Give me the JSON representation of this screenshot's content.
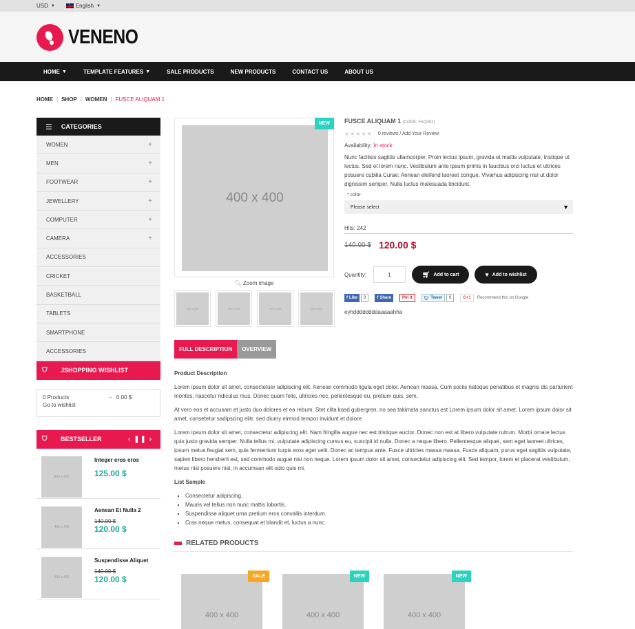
{
  "topbar": {
    "currency": "USD",
    "language": "English"
  },
  "logo": {
    "text": "VENENO"
  },
  "nav": [
    "HOME",
    "TEMPLATE FEATURES",
    "SALE PRODUCTS",
    "NEW PRODUCTS",
    "CONTACT US",
    "ABOUT US"
  ],
  "breadcrumb": {
    "home": "HOME",
    "shop": "SHOP",
    "women": "WOMEN",
    "current": "FUSCE ALIQUAM 1"
  },
  "categories": {
    "title": "CATEGORIES",
    "items": [
      {
        "label": "WOMEN",
        "expand": "+"
      },
      {
        "label": "MEN",
        "expand": "+"
      },
      {
        "label": "FOOTWEAR",
        "expand": "+"
      },
      {
        "label": "JEWELLERY",
        "expand": "+"
      },
      {
        "label": "COMPUTER",
        "expand": "+"
      },
      {
        "label": "CAMERA",
        "expand": "+"
      },
      {
        "label": "ACCESSORIES",
        "expand": ""
      },
      {
        "label": "CRICKET",
        "expand": ""
      },
      {
        "label": "BASKETBALL",
        "expand": ""
      },
      {
        "label": "TABLETS",
        "expand": ""
      },
      {
        "label": "SMARTPHONE",
        "expand": ""
      },
      {
        "label": "ACCESSORIES",
        "expand": ""
      }
    ]
  },
  "wishlist": {
    "title": "JSHOPPING WISHLIST",
    "products": "0 Products",
    "dash": "-",
    "total": "0.00 $",
    "link": "Go to wishlist"
  },
  "bestseller": {
    "title": "BESTSELLER",
    "items": [
      {
        "name": "Integer eros eros",
        "old_price": "",
        "price": "125.00 $"
      },
      {
        "name": "Aenean Et Nulla 2",
        "old_price": "140.00 $",
        "price": "120.00 $"
      },
      {
        "name": "Suspendisse Aliquet",
        "old_price": "140.00 $",
        "price": "120.00 $"
      }
    ]
  },
  "placeholder": {
    "large": "400 x 400",
    "small": "400 x 400"
  },
  "product": {
    "badge": "NEW",
    "zoom_label": "Zoom image",
    "title": "FUSCE ALIQUAM 1",
    "code": "(CODE: FAQ001)",
    "reviews": "0 reviews / Add Your Review",
    "availability_label": "Availability:",
    "availability_value": "In stock",
    "description": "Nunc facilisis sagittis ullamcorper. Proin lectus ipsum, gravida et mattis vulputate, tristique ut lectus. Sed et lorem nunc. Vestibulum ante ipsum primis in faucibus orci luctus et ultrices posuere cubilia Curae; Aenean eleifend laoreet congue. Vivamus adipiscing nisl ut dolor dignissim semper. Nulla luctus malesuada tincidunt.",
    "color_label": "* color",
    "select_placeholder": "Please select",
    "hits": "Hits: 242",
    "old_price": "140.00 $",
    "price": "120.00 $",
    "quantity_label": "Quantity:",
    "quantity": "1",
    "add_to_cart": "Add to cart",
    "add_to_wishlist": "Add to wishlist",
    "extra_text": "eyhddddddddaaaaahha"
  },
  "social": {
    "like": "Like",
    "like_count": "0",
    "share": "Share",
    "pin": "Pin it",
    "tweet": "Tweet",
    "tweet_count": "0",
    "gplus": "G+1",
    "gplus_text": "Recommend this on Google"
  },
  "tabs": {
    "full": "FULL DESCRIPTION",
    "overview": "OVERVIEW"
  },
  "content": {
    "heading": "Product Description",
    "p1": "Lorem ipsum dolor sit amet, consectetuer adipiscing elit. Aenean commodo ligula eget dolor. Aenean massa. Cum sociis natoque penatibus et magnis dis parturient montes, nascetur ridiculus mus. Donec quam felis, ultricies nec, pellentesque eu, pretium quis, sem.",
    "p2": "At vero eos et accusam et justo duo dolores et ea rebum. Stet clita kasd gubergren, no sea takimata sanctus est Lorem ipsum dolor sit amet. Lorem ipsum dolor sit amet, consetetur sadipscing elitr, sed diumy eirmod tempor invidunt et dolore",
    "p3": "Lorem ipsum dolor sit amet, consectetur adipiscing elit. Nam fringilla augue nec est tristique auctor. Donec non est at libero vulputate rutrum. Morbi ornare lectus quis justo gravida semper. Nulla tellus mi, vulputate adipiscing cursus eu, suscipit id nulla. Donec a neque libero. Pellentesque aliquet, sem eget laoreet ultrices, ipsum metus feugiat sem, quis fermentum turpis eros eget velit. Donec ac tempus ante. Fusce ultricies massa massa. Fusce aliquam, purus eget sagittis vulputate, sapien libero hendrerit est, sed commodo augue nisi non neque. Lorem ipsum dolor sit amet, consectetur adipiscing elit. Sed tempor, lorem et placerat vestibulum, metus nisi posuere nisl, in accumsan elit odio quis mi.",
    "list_heading": "List Sample",
    "list": [
      "Consectetur adipiscing.",
      "Mauris vel tellus non nunc mattis lobortis.",
      "Suspendisse aliquet urna pretium eros convallis interdum.",
      "Cras neque metus, consequat et blandit et, luctus a nunc."
    ]
  },
  "related": {
    "title": "RELATED PRODUCTS",
    "badges": [
      "SALE",
      "NEW",
      "NEW"
    ]
  },
  "colors": {
    "accent": "#e8194f",
    "teal": "#1ea89a",
    "dark": "#1a1a1a",
    "price_red": "#b0112d"
  }
}
